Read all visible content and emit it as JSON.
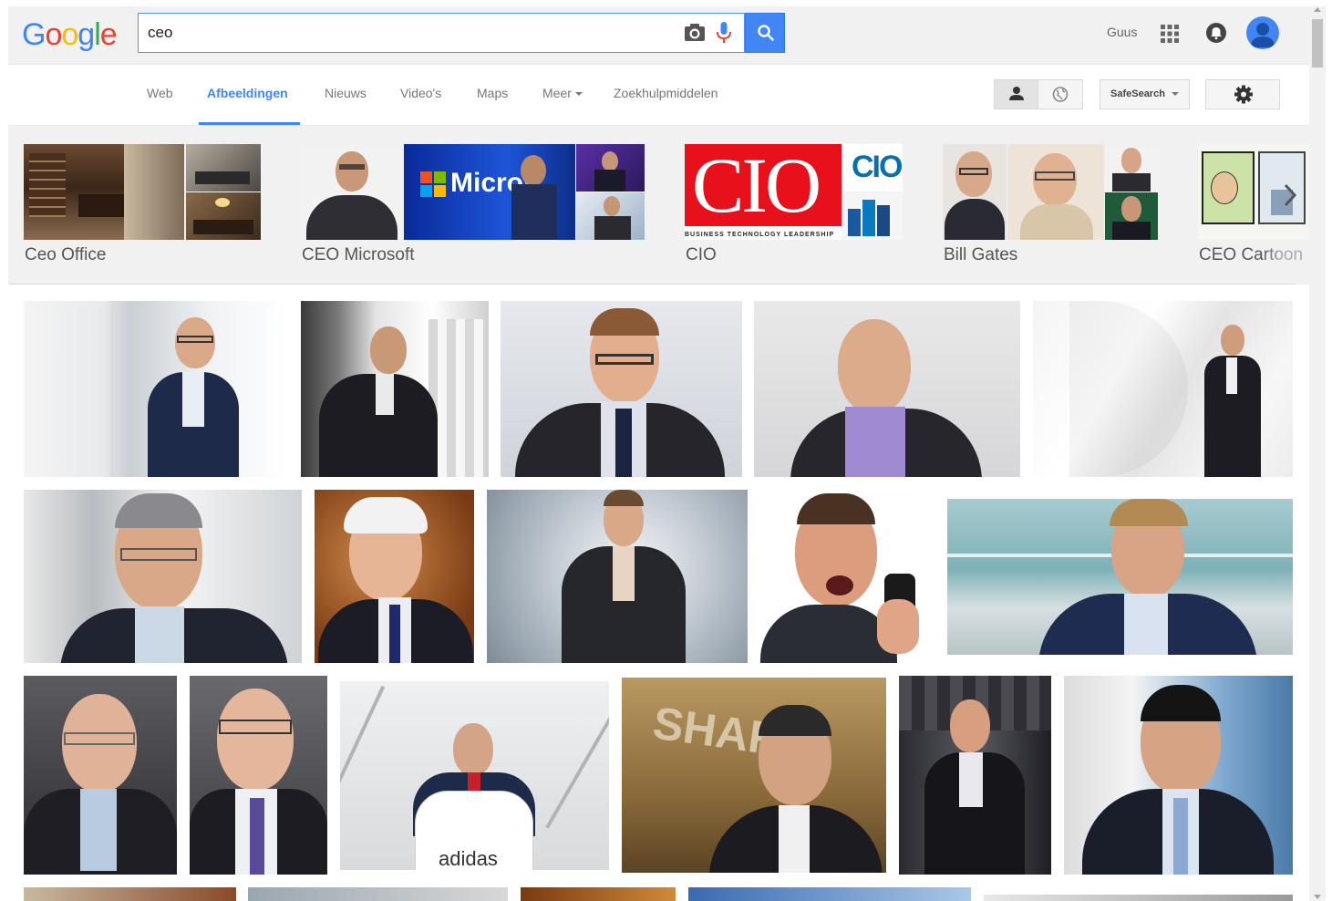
{
  "header": {
    "logo_letters": [
      "G",
      "o",
      "o",
      "g",
      "l",
      "e"
    ],
    "search_value": "ceo",
    "user_name": "Guus",
    "accent_color": "#4285f4"
  },
  "nav": {
    "tabs": [
      {
        "label": "Web"
      },
      {
        "label": "Afbeeldingen"
      },
      {
        "label": "Nieuws"
      },
      {
        "label": "Video's"
      },
      {
        "label": "Maps"
      },
      {
        "label": "Meer"
      },
      {
        "label": "Zoekhulpmiddelen"
      }
    ],
    "safesearch_label": "SafeSearch"
  },
  "related": [
    {
      "label": "Ceo Office"
    },
    {
      "label": "CEO Microsoft"
    },
    {
      "label": "CIO"
    },
    {
      "label": "Bill Gates"
    },
    {
      "label": "CEO Cartoon"
    }
  ],
  "related_image_text": {
    "microsoft": "Micros",
    "cio": "CIO",
    "cio_small": "CIO",
    "cio_tagline": "BUSINESS TECHNOLOGY LEADERSHIP"
  },
  "result_image_text": {
    "adidas": "adidas",
    "sharp": "SHAR"
  },
  "icons": [
    "camera-icon",
    "microphone-icon",
    "search-icon",
    "apps-grid-icon",
    "notifications-icon",
    "avatar",
    "person-icon",
    "globe-icon",
    "gear-icon",
    "chevron-right-icon"
  ]
}
